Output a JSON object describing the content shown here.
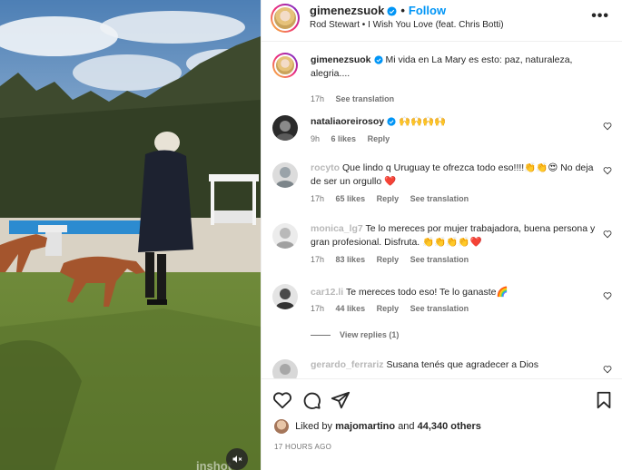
{
  "media": {
    "watermark": "inshot"
  },
  "header": {
    "username": "gimenezsuok",
    "follow_label": "Follow",
    "dot": "•",
    "audio": "Rod Stewart • I Wish You Love (feat. Chris Botti)",
    "more": "•••"
  },
  "comments": [
    {
      "username": "gimenezsuok",
      "text": "Mi vida en La Mary es esto: paz, naturaleza, alegria....",
      "time": "17h",
      "translate": "See translation"
    },
    {
      "username": "nataliaoreirosoy",
      "text": "🙌🙌🙌🙌",
      "time": "9h",
      "likes": "6 likes",
      "reply": "Reply"
    },
    {
      "username": "rocyto",
      "text": "Que lindo q Uruguay te ofrezca todo eso!!!!👏👏😍 No deja de ser un orgullo ❤️",
      "time": "17h",
      "likes": "65 likes",
      "reply": "Reply",
      "translate": "See translation"
    },
    {
      "username": "monica_lg7",
      "text": "Te lo mereces por mujer trabajadora, buena persona y gran profesional. Disfruta. 👏👏👏👏❤️",
      "time": "17h",
      "likes": "83 likes",
      "reply": "Reply",
      "translate": "See translation"
    },
    {
      "username": "car12.li",
      "text": "Te mereces todo eso! Te lo ganaste🌈",
      "time": "17h",
      "likes": "44 likes",
      "reply": "Reply",
      "translate": "See translation"
    },
    {
      "username": "gerardo_ferrariz",
      "text": "Susana tenés que agradecer a Dios"
    }
  ],
  "view_replies": "View replies (1)",
  "footer": {
    "liked_prefix": "Liked by",
    "liked_user": "majomartino",
    "liked_and": "and",
    "liked_count": "44,340 others",
    "ago": "17 HOURS AGO"
  },
  "icons": {
    "like": "heart-icon",
    "comment": "comment-icon",
    "share": "send-icon",
    "save": "bookmark-icon",
    "mute": "speaker-muted-icon",
    "verified": "verified-badge-icon"
  },
  "colors": {
    "follow": "#0095f6",
    "verified": "#0095f6",
    "secondary_text": "#737373",
    "heart_red": "#ed4956"
  }
}
